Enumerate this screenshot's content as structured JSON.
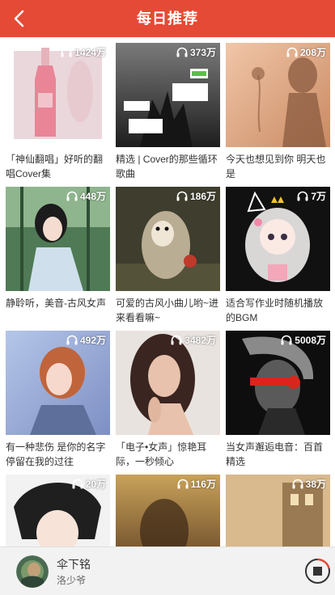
{
  "header": {
    "title": "每日推荐",
    "back_icon": "chevron-left-icon",
    "bg_color": "#e44a36"
  },
  "playlists": [
    {
      "title": "「神仙翻唱」好听的翻唱Cover集",
      "count": "1424万"
    },
    {
      "title": "精选 | Cover的那些循环歌曲",
      "count": "373万"
    },
    {
      "title": "今天也想见到你 明天也是",
      "count": "208万"
    },
    {
      "title": "静聆听，美音-古风女声",
      "count": "448万"
    },
    {
      "title": "可爱的古风小曲儿哟~进来看看嘛~",
      "count": "186万"
    },
    {
      "title": "适合写作业时随机播放的BGM",
      "count": "7万"
    },
    {
      "title": "有一种悲伤 是你的名字停留在我的过往",
      "count": "492万"
    },
    {
      "title": "「电子•女声」惊艳耳际，一秒倾心",
      "count": "3482万"
    },
    {
      "title": "当女声邂逅电音：百首精选",
      "count": "5008万"
    },
    {
      "title": "",
      "count": "20万"
    },
    {
      "title": "",
      "count": "116万"
    },
    {
      "title": "",
      "count": "38万"
    }
  ],
  "player": {
    "song": "伞下铭",
    "artist": "洛少爷",
    "stop_icon": "stop-icon"
  }
}
